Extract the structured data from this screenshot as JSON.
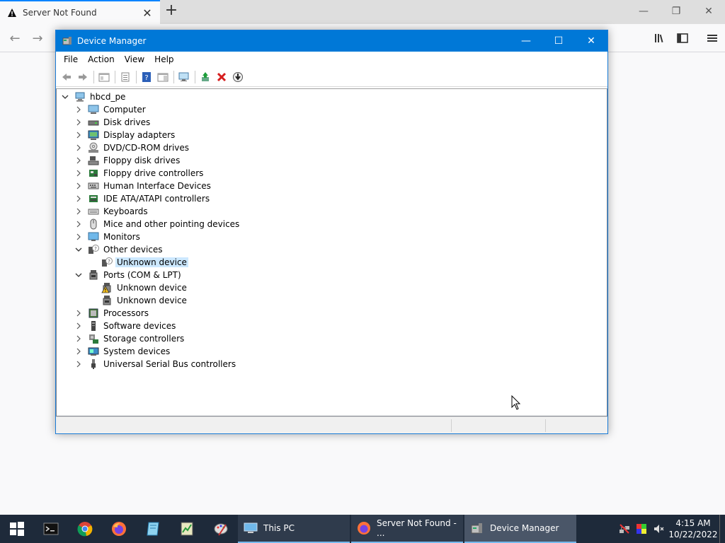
{
  "browser": {
    "tab_title": "Server Not Found",
    "tab_close": "✕",
    "new_tab": "+",
    "minimize": "—",
    "restore": "❐",
    "close": "✕",
    "back": "←",
    "forward": "→"
  },
  "window": {
    "title": "Device Manager",
    "minimize": "—",
    "maximize": "☐",
    "close": "✕"
  },
  "menu": [
    "File",
    "Action",
    "View",
    "Help"
  ],
  "tree": {
    "root": "hbcd_pe",
    "categories": [
      {
        "label": "Computer",
        "icon": "computer-icon"
      },
      {
        "label": "Disk drives",
        "icon": "disk-drive-icon"
      },
      {
        "label": "Display adapters",
        "icon": "display-adapter-icon"
      },
      {
        "label": "DVD/CD-ROM drives",
        "icon": "dvd-icon"
      },
      {
        "label": "Floppy disk drives",
        "icon": "floppy-icon"
      },
      {
        "label": "Floppy drive controllers",
        "icon": "floppy-controller-icon"
      },
      {
        "label": "Human Interface Devices",
        "icon": "hid-icon"
      },
      {
        "label": "IDE ATA/ATAPI controllers",
        "icon": "ide-icon"
      },
      {
        "label": "Keyboards",
        "icon": "keyboard-icon"
      },
      {
        "label": "Mice and other pointing devices",
        "icon": "mouse-icon"
      },
      {
        "label": "Monitors",
        "icon": "monitor-icon"
      },
      {
        "label": "Other devices",
        "icon": "other-devices-icon",
        "expanded": true,
        "children": [
          {
            "label": "Unknown device",
            "icon": "unknown-device-icon",
            "selected": true
          }
        ]
      },
      {
        "label": "Ports (COM & LPT)",
        "icon": "port-icon",
        "expanded": true,
        "children": [
          {
            "label": "Unknown device",
            "icon": "warning-port-icon"
          },
          {
            "label": "Unknown device",
            "icon": "port-icon"
          }
        ]
      },
      {
        "label": "Processors",
        "icon": "processor-icon"
      },
      {
        "label": "Software devices",
        "icon": "software-device-icon"
      },
      {
        "label": "Storage controllers",
        "icon": "storage-controller-icon"
      },
      {
        "label": "System devices",
        "icon": "system-devices-icon"
      },
      {
        "label": "Universal Serial Bus controllers",
        "icon": "usb-icon"
      }
    ]
  },
  "taskbar": {
    "tasks": [
      {
        "label": "This PC",
        "icon": "this-pc-icon"
      },
      {
        "label": "Server Not Found - ...",
        "icon": "firefox-icon"
      },
      {
        "label": "Device Manager",
        "icon": "device-manager-icon"
      }
    ],
    "time": "4:15 AM",
    "date": "10/22/2022"
  },
  "colors": {
    "titlebar": "#0078d7",
    "taskbar": "#1e2a3a",
    "selection": "#cce8ff"
  }
}
